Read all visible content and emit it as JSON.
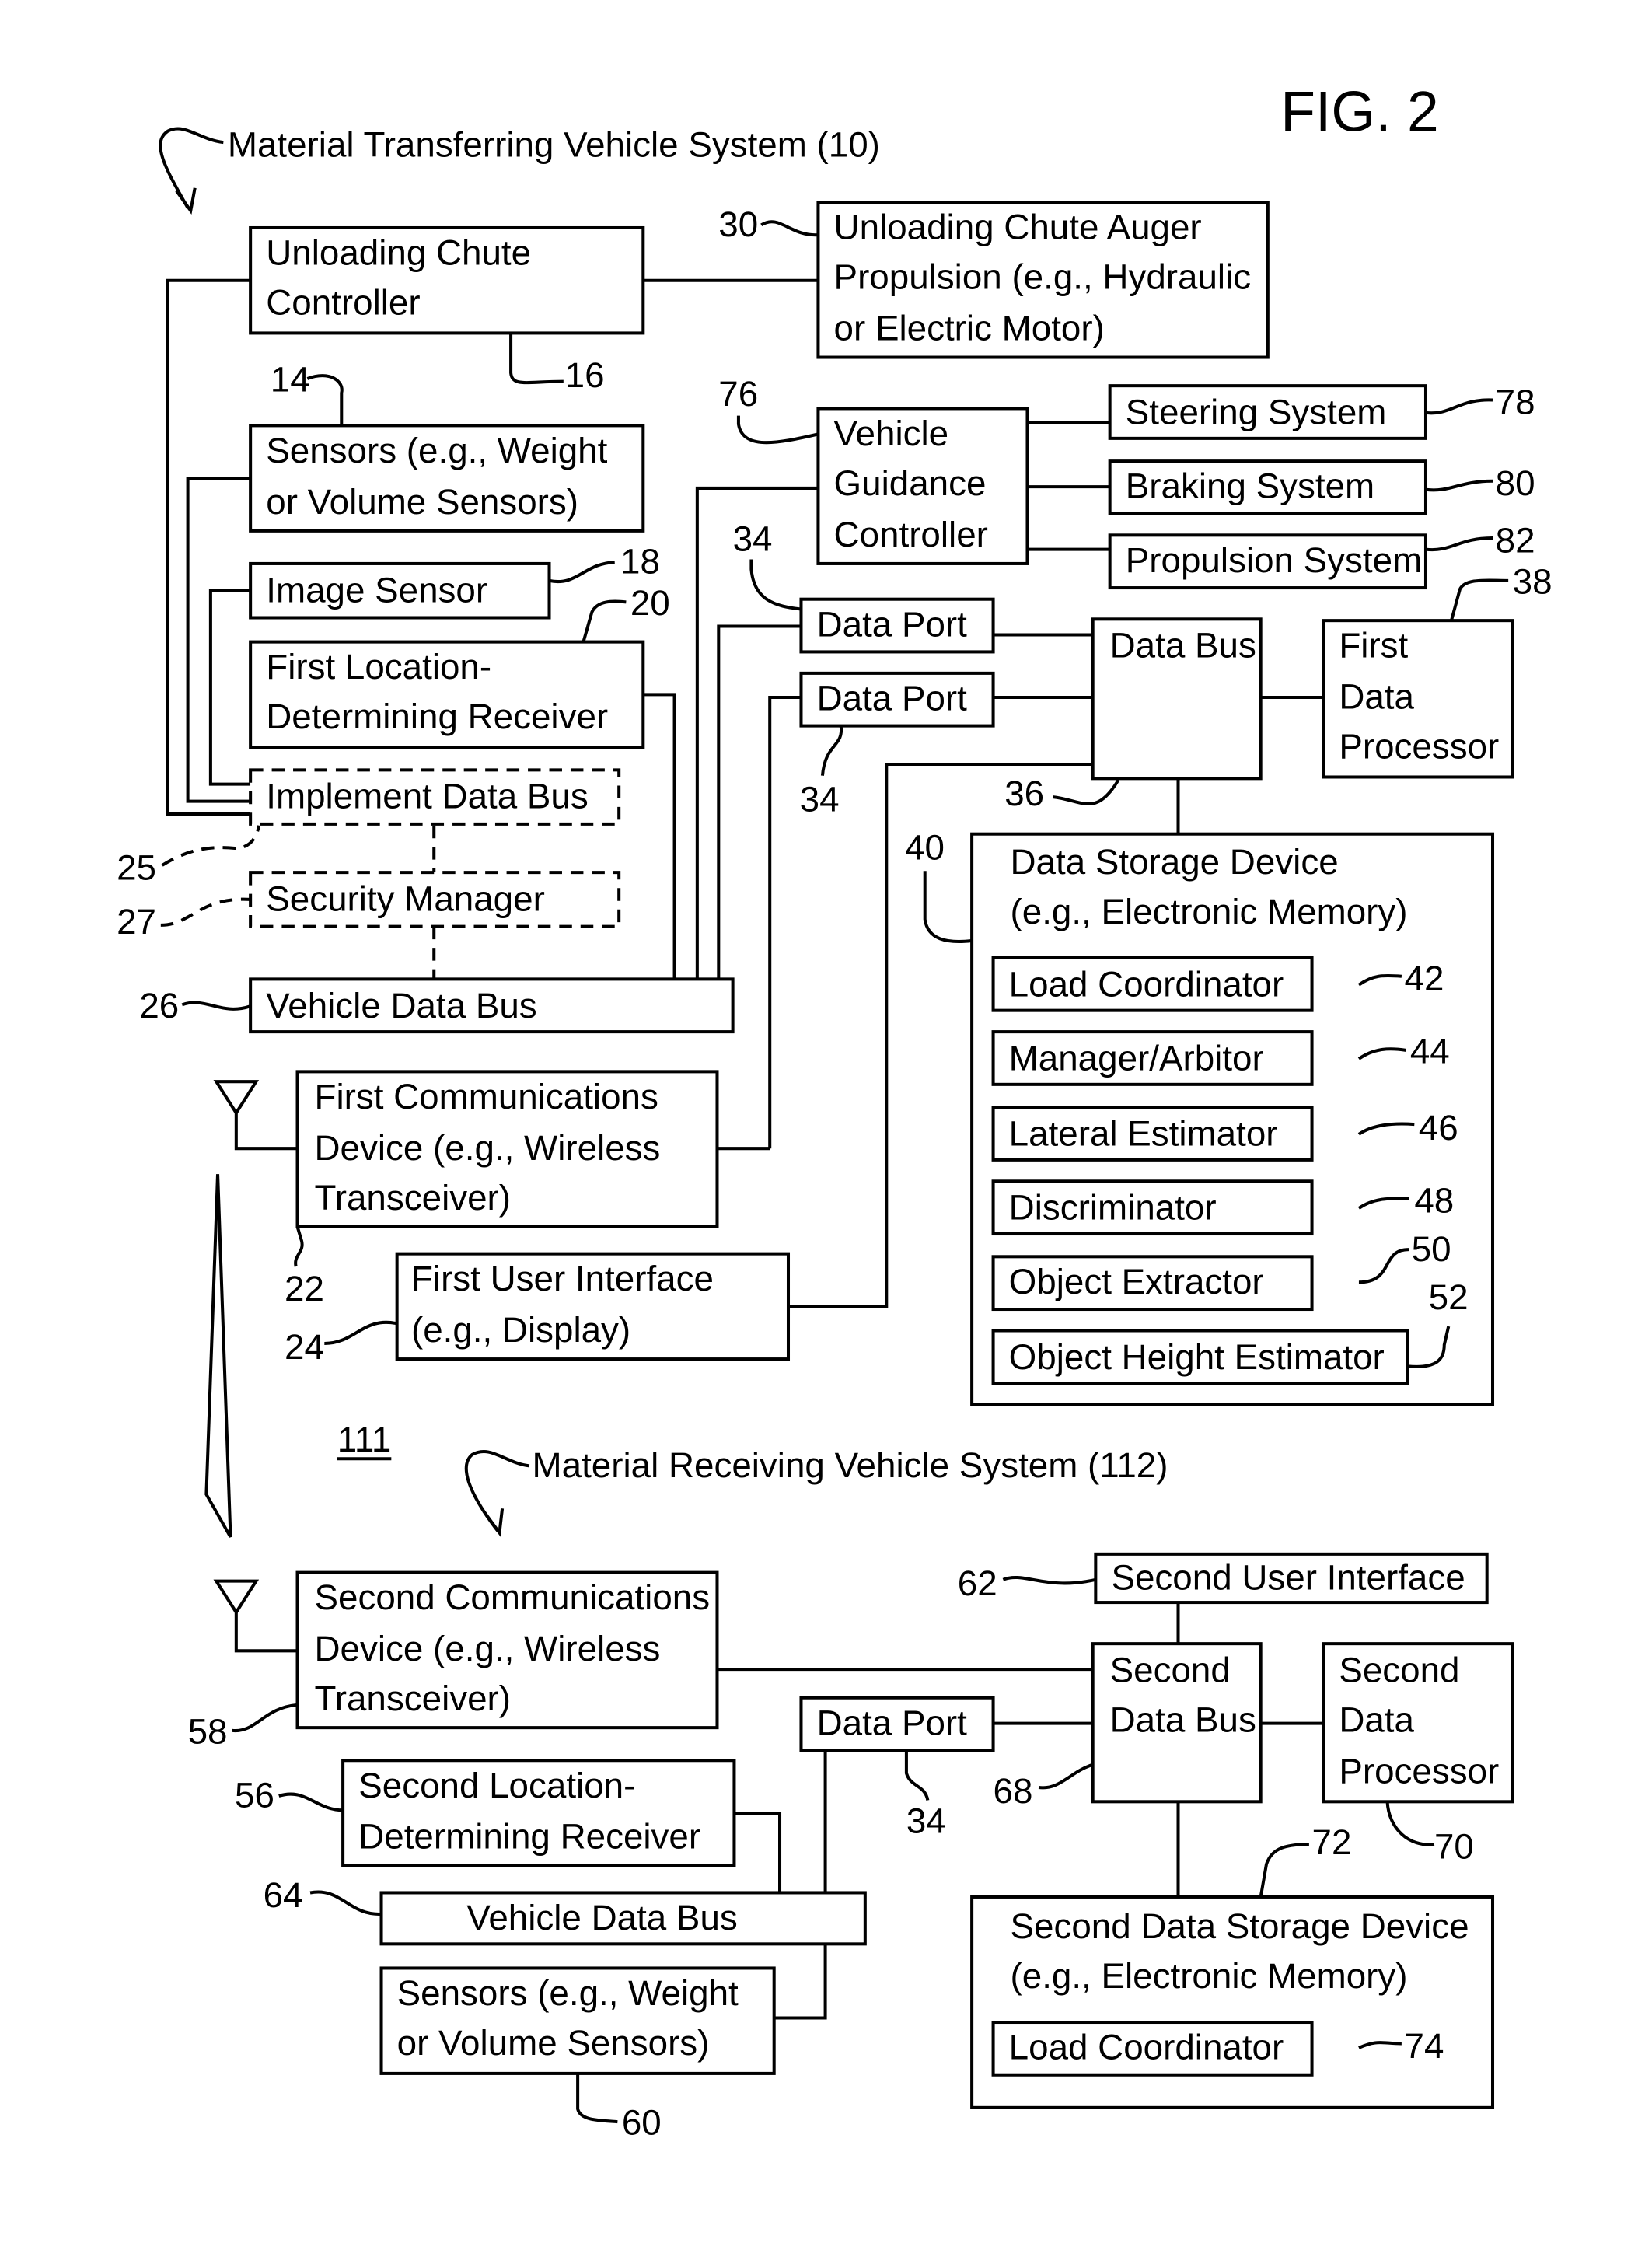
{
  "figure_label": "FIG. 2",
  "systems": {
    "transferring": {
      "label": "Material Transferring Vehicle System (10)"
    },
    "receiving": {
      "label": "Material Receiving Vehicle System (112)"
    },
    "link_ref": "111"
  },
  "blocks": {
    "chute_controller": [
      "Unloading Chute",
      "Controller"
    ],
    "auger": [
      "Unloading Chute Auger",
      "Propulsion (e.g., Hydraulic",
      "or Electric Motor)"
    ],
    "sensors1": [
      "Sensors (e.g., Weight",
      "or Volume Sensors)"
    ],
    "image_sensor": [
      "Image Sensor"
    ],
    "loc1": [
      "First Location-",
      "Determining Receiver"
    ],
    "impl_bus": [
      "Implement Data Bus"
    ],
    "security": [
      "Security Manager"
    ],
    "vbus1": [
      "Vehicle Data Bus"
    ],
    "comm1": [
      "First Communications",
      "Device (e.g., Wireless",
      "Transceiver)"
    ],
    "ui1": [
      "First User Interface",
      "(e.g., Display)"
    ],
    "guidance": [
      "Vehicle",
      "Guidance",
      "Controller"
    ],
    "steering": [
      "Steering System"
    ],
    "braking": [
      "Braking System"
    ],
    "propulsion": [
      "Propulsion System"
    ],
    "port_a": [
      "Data Port"
    ],
    "port_b": [
      "Data Port"
    ],
    "dbus1": [
      "Data Bus"
    ],
    "proc1": [
      "First",
      "Data",
      "Processor"
    ],
    "storage1": [
      "Data Storage Device",
      "(e.g., Electronic Memory)"
    ],
    "load_coord": [
      "Load Coordinator"
    ],
    "manager": [
      "Manager/Arbitor"
    ],
    "lateral": [
      "Lateral Estimator"
    ],
    "discrim": [
      "Discriminator"
    ],
    "extractor": [
      "Object Extractor"
    ],
    "height": [
      "Object Height Estimator"
    ],
    "ui2": [
      "Second User Interface"
    ],
    "comm2": [
      "Second Communications",
      "Device (e.g., Wireless",
      "Transceiver)"
    ],
    "port_c": [
      "Data Port"
    ],
    "dbus2": [
      "Second",
      "Data Bus"
    ],
    "proc2": [
      "Second",
      "Data",
      "Processor"
    ],
    "loc2": [
      "Second Location-",
      "Determining Receiver"
    ],
    "vbus2": [
      "Vehicle Data Bus"
    ],
    "sensors2": [
      "Sensors (e.g., Weight",
      "or Volume Sensors)"
    ],
    "storage2": [
      "Second Data Storage Device",
      "(e.g., Electronic Memory)"
    ],
    "load_coord2": [
      "Load Coordinator"
    ]
  },
  "refs": {
    "r30": "30",
    "r16": "16",
    "r14": "14",
    "r18": "18",
    "r20": "20",
    "r25": "25",
    "r27": "27",
    "r26": "26",
    "r22": "22",
    "r24": "24",
    "r76": "76",
    "r78": "78",
    "r80": "80",
    "r82": "82",
    "r38": "38",
    "r34a": "34",
    "r34b": "34",
    "r36": "36",
    "r40": "40",
    "r42": "42",
    "r44": "44",
    "r46": "46",
    "r48": "48",
    "r50": "50",
    "r52": "52",
    "r62": "62",
    "r58": "58",
    "r34c": "34",
    "r68": "68",
    "r70": "70",
    "r56": "56",
    "r64": "64",
    "r60": "60",
    "r72": "72",
    "r74": "74"
  }
}
